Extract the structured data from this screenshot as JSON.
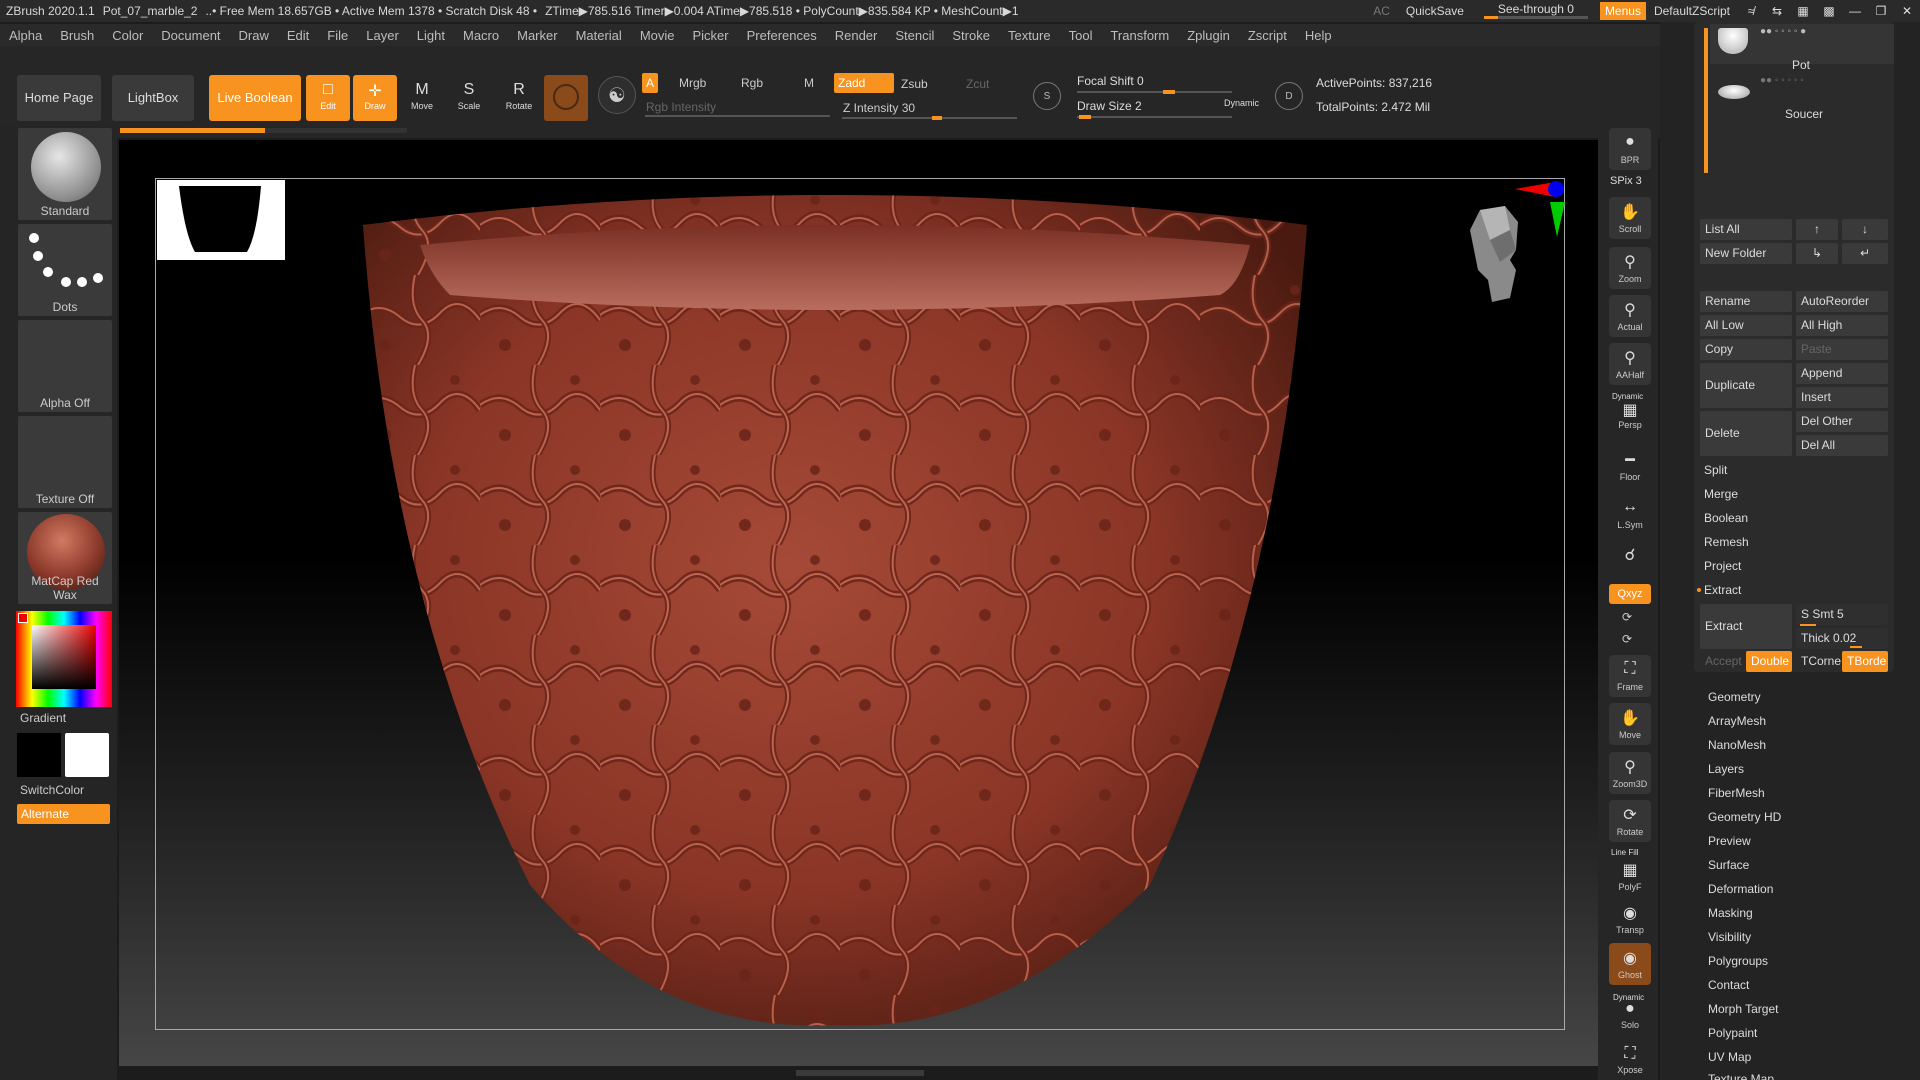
{
  "titlebar": {
    "app": "ZBrush 2020.1.1",
    "doc": "Pot_07_marble_2",
    "mem": "..• Free Mem 18.657GB • Active Mem 1378 • Scratch Disk 48 •",
    "time": "ZTime▶785.516 Timer▶0.004 ATime▶785.518 • PolyCount▶835.584 KP • MeshCount▶1",
    "ac": "AC",
    "quicksave": "QuickSave",
    "seethrough": "See-through",
    "seethrough_value": "0",
    "menus": "Menus",
    "script": "DefaultZScript"
  },
  "menubar": [
    "Alpha",
    "Brush",
    "Color",
    "Document",
    "Draw",
    "Edit",
    "File",
    "Layer",
    "Light",
    "Macro",
    "Marker",
    "Material",
    "Movie",
    "Picker",
    "Preferences",
    "Render",
    "Stencil",
    "Stroke",
    "Texture",
    "Tool",
    "Transform",
    "Zplugin",
    "Zscript",
    "Help"
  ],
  "shelf": {
    "home": "Home Page",
    "lightbox": "LightBox",
    "liveboolean": "Live Boolean",
    "tools": {
      "edit": "Edit",
      "draw": "Draw",
      "move": "Move",
      "scale": "Scale",
      "rotate": "Rotate"
    },
    "a": "A",
    "mrgb": "Mrgb",
    "rgb": "Rgb",
    "m": "M",
    "zadd": "Zadd",
    "zsub": "Zsub",
    "zcut": "Zcut",
    "rgb_intensity": "Rgb Intensity",
    "z_intensity": "Z Intensity 30",
    "focal_shift": "Focal Shift 0",
    "draw_size": "Draw Size 2",
    "dynamic": "Dynamic",
    "active_points": "ActivePoints: 837,216",
    "total_points": "TotalPoints: 2.472 Mil"
  },
  "lefttray": {
    "brush": "Standard",
    "stroke": "Dots",
    "alpha": "Alpha Off",
    "texture": "Texture Off",
    "material": "MatCap Red Wax",
    "gradient": "Gradient",
    "switchcolor": "SwitchColor",
    "alternate": "Alternate"
  },
  "rightstrip": {
    "bpr": "BPR",
    "spix": "SPix 3",
    "scroll": "Scroll",
    "zoom": "Zoom",
    "actual": "Actual",
    "aahalf": "AAHalf",
    "dynamic": "Dynamic",
    "persp": "Persp",
    "floor": "Floor",
    "lsym": "L.Sym",
    "xyz": "Qxyz",
    "frame": "Frame",
    "move": "Move",
    "zoom3d": "Zoom3D",
    "rotate": "Rotate",
    "linefill": "Line Fill",
    "polyf": "PolyF",
    "transp": "Transp",
    "ghost": "Ghost",
    "solo_dynamic": "Dynamic",
    "solo": "Solo",
    "xpose": "Xpose"
  },
  "subtools": [
    {
      "name": "Pot"
    },
    {
      "name": "Soucer"
    }
  ],
  "panel": {
    "list_all": "List All",
    "new_folder": "New Folder",
    "rename": "Rename",
    "autoreorder": "AutoReorder",
    "all_low": "All Low",
    "all_high": "All High",
    "copy": "Copy",
    "paste": "Paste",
    "duplicate": "Duplicate",
    "append": "Append",
    "insert": "Insert",
    "delete": "Delete",
    "del_other": "Del Other",
    "del_all": "Del All",
    "split": "Split",
    "merge": "Merge",
    "boolean": "Boolean",
    "remesh": "Remesh",
    "project": "Project",
    "extract_header": "Extract",
    "extract": "Extract",
    "s_smt": "S Smt 5",
    "thick": "Thick 0.02",
    "accept": "Accept",
    "double": "Double",
    "tcorne": "TCorne",
    "tborde": "TBorde"
  },
  "sections": [
    "Geometry",
    "ArrayMesh",
    "NanoMesh",
    "Layers",
    "FiberMesh",
    "Geometry HD",
    "Preview",
    "Surface",
    "Deformation",
    "Masking",
    "Visibility",
    "Polygroups",
    "Contact",
    "Morph Target",
    "Polypaint",
    "UV Map",
    "Texture Map"
  ],
  "colors": {
    "accent": "#f7931e",
    "clay": "#8c3a2c",
    "panel": "#2b2b2b"
  }
}
